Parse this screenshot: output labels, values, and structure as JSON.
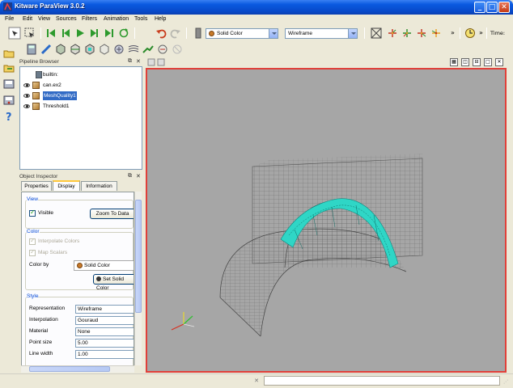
{
  "window": {
    "title": "Kitware ParaView 3.0.2",
    "minimize": "_",
    "maximize": "□",
    "close": "✕"
  },
  "menu": [
    "File",
    "Edit",
    "View",
    "Sources",
    "Filters",
    "Animation",
    "Tools",
    "Help"
  ],
  "toolbar": {
    "color_combo": "Solid Color",
    "representation_combo": "Wireframe",
    "overflow": "»",
    "time_label": "Time:"
  },
  "pipeline_browser": {
    "title": "Pipeline Browser",
    "items": [
      {
        "label": "builtin:",
        "visible": null,
        "selected": false
      },
      {
        "label": "can.ex2",
        "visible": true,
        "selected": false
      },
      {
        "label": "MeshQuality1",
        "visible": true,
        "selected": true
      },
      {
        "label": "Threshold1",
        "visible": true,
        "selected": false
      }
    ]
  },
  "object_inspector": {
    "title": "Object Inspector",
    "tabs": [
      "Properties",
      "Display",
      "Information"
    ],
    "active_tab": "Display",
    "view_group": {
      "title": "View",
      "visible_label": "Visible",
      "visible_checked": true,
      "zoom_button": "Zoom To Data"
    },
    "color_group": {
      "title": "Color",
      "interpolate_label": "Interpolate Colors",
      "map_scalars_label": "Map Scalars",
      "color_by_label": "Color by",
      "color_by_value": "Solid Color",
      "set_solid_button": "Set Solid Color"
    },
    "style_group": {
      "title": "Style",
      "rows": [
        {
          "label": "Representation",
          "value": "Wireframe"
        },
        {
          "label": "Interpolation",
          "value": "Gouraud"
        },
        {
          "label": "Material",
          "value": "None"
        },
        {
          "label": "Point size",
          "value": "5.00"
        },
        {
          "label": "Line width",
          "value": "1.00"
        }
      ]
    }
  },
  "colors": {
    "mesh_wire": "#505050",
    "threshold": "#2fd6c6",
    "viewport_bg": "#a6a6a6",
    "active_border": "#e0403a"
  }
}
